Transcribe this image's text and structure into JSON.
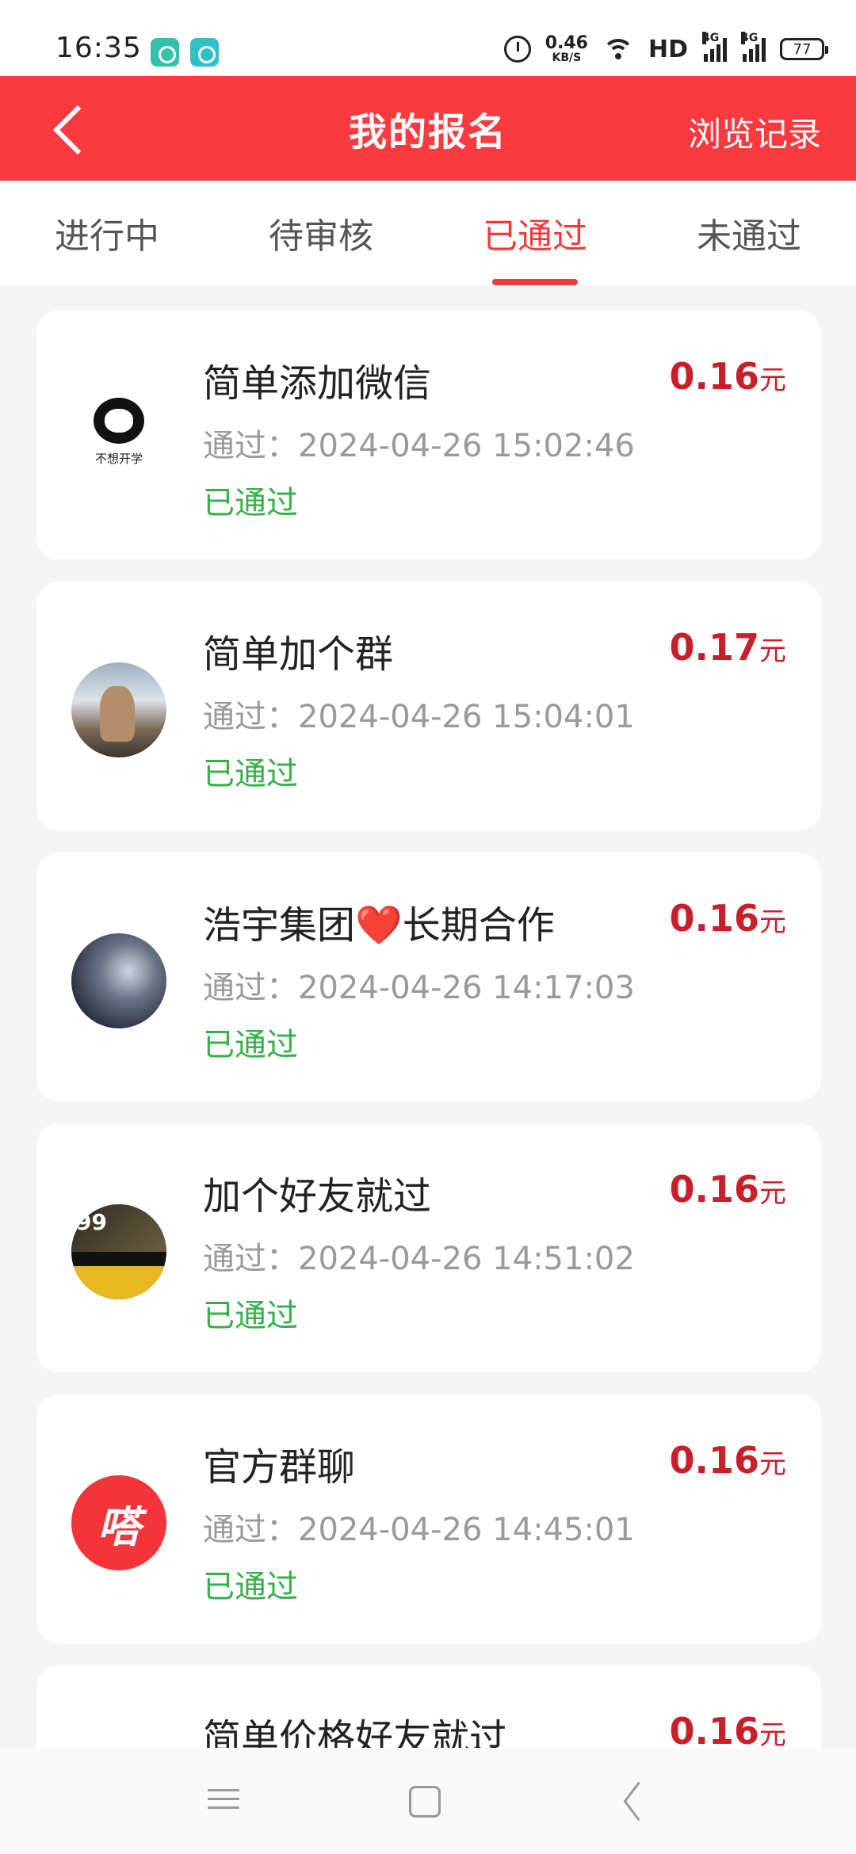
{
  "status_bar": {
    "time": "16:35",
    "net_speed_value": "0.46",
    "net_speed_unit": "KB/S",
    "hd_label": "HD",
    "signal1_label": "4G",
    "signal2_label": "4G",
    "battery": "77",
    "icons": [
      "app-icon-green",
      "app-icon-teal",
      "alarm-icon",
      "wifi-icon",
      "signal-icon",
      "battery-icon"
    ]
  },
  "header": {
    "title": "我的报名",
    "history_label": "浏览记录"
  },
  "tabs": [
    {
      "label": "进行中",
      "active": false
    },
    {
      "label": "待审核",
      "active": false
    },
    {
      "label": "已通过",
      "active": true
    },
    {
      "label": "未通过",
      "active": false
    }
  ],
  "items": [
    {
      "title": "简单添加微信",
      "time": "通过：2024-04-26 15:02:46",
      "status": "已通过",
      "price": "0.16",
      "unit": "元",
      "avatar_caption": "不想开学"
    },
    {
      "title": "简单加个群",
      "time": "通过：2024-04-26 15:04:01",
      "status": "已通过",
      "price": "0.17",
      "unit": "元"
    },
    {
      "title": "浩宇集团❤️长期合作",
      "time": "通过：2024-04-26 14:17:03",
      "status": "已通过",
      "price": "0.16",
      "unit": "元"
    },
    {
      "title": "加个好友就过",
      "time": "通过：2024-04-26 14:51:02",
      "status": "已通过",
      "price": "0.16",
      "unit": "元",
      "avatar_text": "99"
    },
    {
      "title": "官方群聊",
      "time": "通过：2024-04-26 14:45:01",
      "status": "已通过",
      "price": "0.16",
      "unit": "元",
      "avatar_glyph": "嗒"
    },
    {
      "title": "简单价格好友就过",
      "time": "",
      "status": "",
      "price": "0.16",
      "unit": "元"
    }
  ],
  "colors": {
    "brand_red": "#fa3a3f",
    "tab_active": "#f23a3a",
    "price": "#c91f2a",
    "status_green": "#36b04a"
  }
}
